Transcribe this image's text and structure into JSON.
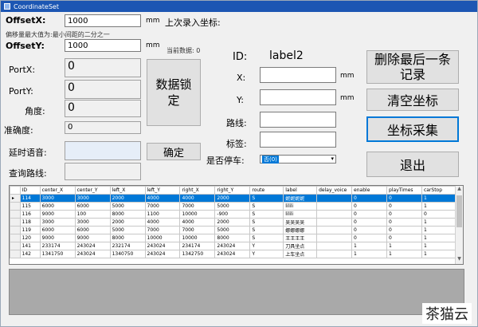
{
  "window": {
    "title": "CoordinateSet"
  },
  "left": {
    "offset_x_label": "OffsetX:",
    "offset_x_value": "1000",
    "offset_x_unit": "mm",
    "hint": "偏移量最大值为:最小间距的二分之一",
    "offset_y_label": "OffsetY:",
    "offset_y_value": "1000",
    "offset_y_unit": "mm",
    "port_x_label": "PortX:",
    "port_x_value": "0",
    "port_y_label": "PortY:",
    "port_y_value": "0",
    "angle_label": "角度:",
    "angle_value": "0",
    "accuracy_label": "准确度:",
    "accuracy_value": "0",
    "delay_voice_label": "延时语音:",
    "query_route_label": "查询路线:"
  },
  "middle": {
    "last_entry_label": "上次录入坐标:",
    "current_data_label": "当前数据: 0",
    "lock_data_button": "数据锁定",
    "confirm_button": "确定",
    "stop_label": "是否停车:",
    "stop_value": "否(0)"
  },
  "form": {
    "id_label": "ID:",
    "id_value": "label2",
    "x_label": "X:",
    "x_unit": "mm",
    "y_label": "Y:",
    "y_unit": "mm",
    "route_label": "路线:",
    "tag_label": "标签:"
  },
  "buttons": {
    "delete_last": "删除最后一条记录",
    "clear": "清空坐标",
    "collect": "坐标采集",
    "exit": "退出"
  },
  "grid": {
    "columns": [
      "ID",
      "center_X",
      "center_Y",
      "left_X",
      "left_Y",
      "right_X",
      "right_Y",
      "route",
      "label",
      "delay_voice",
      "enable",
      "playTimes",
      "carStop"
    ],
    "rows": [
      [
        "114",
        "3000",
        "3000",
        "2000",
        "4000",
        "4000",
        "2000",
        "S",
        "妮妮妮妮",
        "",
        "0",
        "0",
        "1"
      ],
      [
        "115",
        "6000",
        "6000",
        "5000",
        "7000",
        "7000",
        "5000",
        "S",
        "lilili",
        "",
        "0",
        "0",
        "1"
      ],
      [
        "116",
        "9000",
        "100",
        "8000",
        "1100",
        "10000",
        "-900",
        "S",
        "lilili",
        "",
        "0",
        "0",
        "0"
      ],
      [
        "118",
        "3000",
        "3000",
        "2000",
        "4000",
        "4000",
        "2000",
        "S",
        "吴吴吴吴",
        "",
        "0",
        "0",
        "1"
      ],
      [
        "119",
        "6000",
        "6000",
        "5000",
        "7000",
        "7000",
        "5000",
        "S",
        "娜娜娜娜",
        "",
        "0",
        "0",
        "1"
      ],
      [
        "120",
        "9000",
        "9000",
        "8000",
        "10000",
        "10000",
        "8000",
        "S",
        "王王王王",
        "",
        "0",
        "0",
        "1"
      ],
      [
        "141",
        "233174",
        "243024",
        "232174",
        "243024",
        "234174",
        "243024",
        "Y",
        "刀具坐点",
        "",
        "1",
        "1",
        "1"
      ],
      [
        "142",
        "1341750",
        "243024",
        "1340750",
        "243024",
        "1342750",
        "243024",
        "Y",
        "上车坐点",
        "",
        "1",
        "1",
        "1"
      ]
    ]
  },
  "watermark": "茶猫云"
}
